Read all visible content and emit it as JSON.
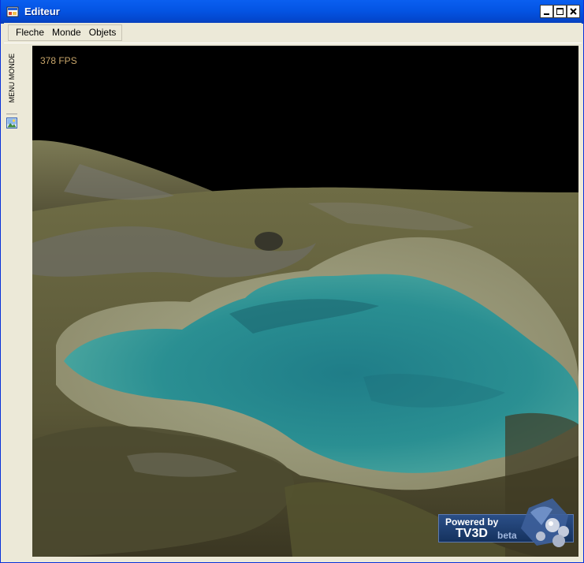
{
  "window": {
    "title": "Editeur"
  },
  "menu": {
    "items": [
      "Fleche",
      "Monde",
      "Objets"
    ]
  },
  "sidebar": {
    "tab_label": "MENU MONDE"
  },
  "viewport": {
    "fps": "378 FPS"
  },
  "badge": {
    "powered": "Powered by",
    "brand": "TV3D",
    "beta": "beta"
  },
  "colors": {
    "titlebar": "#0454e3",
    "water": "#2a8f92",
    "terrain": "#6b6a3f"
  }
}
